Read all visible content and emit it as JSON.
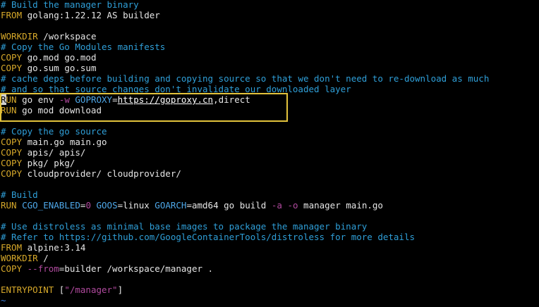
{
  "editor": {
    "lines": [
      [
        {
          "t": "# Build the manager binary",
          "c": "comment"
        }
      ],
      [
        {
          "t": "FROM",
          "c": "keyword"
        },
        {
          "t": " golang:1.22.12 AS builder",
          "c": "text"
        }
      ],
      [],
      [
        {
          "t": "WORKDIR",
          "c": "keyword"
        },
        {
          "t": " /workspace",
          "c": "text"
        }
      ],
      [
        {
          "t": "# Copy the Go Modules manifests",
          "c": "comment"
        }
      ],
      [
        {
          "t": "COPY",
          "c": "keyword"
        },
        {
          "t": " go.mod go.mod",
          "c": "text"
        }
      ],
      [
        {
          "t": "COPY",
          "c": "keyword"
        },
        {
          "t": " go.sum go.sum",
          "c": "text"
        }
      ],
      [
        {
          "t": "# cache deps before building and copying source so that we don't need to re-download as much",
          "c": "comment"
        }
      ],
      [
        {
          "t": "# and so that source changes don't invalidate our downloaded layer",
          "c": "comment"
        }
      ],
      [
        {
          "t": "R",
          "c": "cursor"
        },
        {
          "t": "UN",
          "c": "keyword"
        },
        {
          "t": " go env ",
          "c": "text"
        },
        {
          "t": "-w",
          "c": "flag"
        },
        {
          "t": " ",
          "c": "text"
        },
        {
          "t": "GOPROXY",
          "c": "var"
        },
        {
          "t": "=",
          "c": "text"
        },
        {
          "t": "https://goproxy.cn",
          "c": "url"
        },
        {
          "t": ",direct",
          "c": "text"
        }
      ],
      [
        {
          "t": "RUN",
          "c": "keyword"
        },
        {
          "t": " go mod download",
          "c": "text"
        }
      ],
      [],
      [
        {
          "t": "# Copy the go source",
          "c": "comment"
        }
      ],
      [
        {
          "t": "COPY",
          "c": "keyword"
        },
        {
          "t": " main.go main.go",
          "c": "text"
        }
      ],
      [
        {
          "t": "COPY",
          "c": "keyword"
        },
        {
          "t": " apis/ apis/",
          "c": "text"
        }
      ],
      [
        {
          "t": "COPY",
          "c": "keyword"
        },
        {
          "t": " pkg/ pkg/",
          "c": "text"
        }
      ],
      [
        {
          "t": "COPY",
          "c": "keyword"
        },
        {
          "t": " cloudprovider/ cloudprovider/",
          "c": "text"
        }
      ],
      [],
      [
        {
          "t": "# Build",
          "c": "comment"
        }
      ],
      [
        {
          "t": "RUN",
          "c": "keyword"
        },
        {
          "t": " ",
          "c": "text"
        },
        {
          "t": "CGO_ENABLED",
          "c": "var"
        },
        {
          "t": "=",
          "c": "text"
        },
        {
          "t": "0",
          "c": "flag"
        },
        {
          "t": " ",
          "c": "text"
        },
        {
          "t": "GOOS",
          "c": "var"
        },
        {
          "t": "=linux ",
          "c": "text"
        },
        {
          "t": "GOARCH",
          "c": "var"
        },
        {
          "t": "=amd64 go build ",
          "c": "text"
        },
        {
          "t": "-a",
          "c": "flag"
        },
        {
          "t": " ",
          "c": "text"
        },
        {
          "t": "-o",
          "c": "flag"
        },
        {
          "t": " manager main.go",
          "c": "text"
        }
      ],
      [],
      [
        {
          "t": "# Use distroless as minimal base images to package the manager binary",
          "c": "comment"
        }
      ],
      [
        {
          "t": "# Refer to https://github.com/GoogleContainerTools/distroless for more details",
          "c": "comment"
        }
      ],
      [
        {
          "t": "FROM",
          "c": "keyword"
        },
        {
          "t": " alpine:3.14",
          "c": "text"
        }
      ],
      [
        {
          "t": "WORKDIR",
          "c": "keyword"
        },
        {
          "t": " /",
          "c": "text"
        }
      ],
      [
        {
          "t": "COPY",
          "c": "keyword"
        },
        {
          "t": " ",
          "c": "text"
        },
        {
          "t": "--from",
          "c": "flag"
        },
        {
          "t": "=builder /workspace/manager .",
          "c": "text"
        }
      ],
      [],
      [
        {
          "t": "ENTRYPOINT",
          "c": "keyword"
        },
        {
          "t": " [",
          "c": "text"
        },
        {
          "t": "\"/manager\"",
          "c": "string"
        },
        {
          "t": "]",
          "c": "text"
        }
      ],
      [
        {
          "t": "~",
          "c": "tilde"
        }
      ]
    ]
  },
  "colors": {
    "background": "#000000",
    "comment": "#2f9fd8",
    "keyword": "#d6a82a",
    "text": "#e6e6e6",
    "flag": "#b04a9e",
    "variable": "#4ea7e8",
    "highlight_box": "#e3c33c",
    "tilde": "#3c7ed8"
  }
}
